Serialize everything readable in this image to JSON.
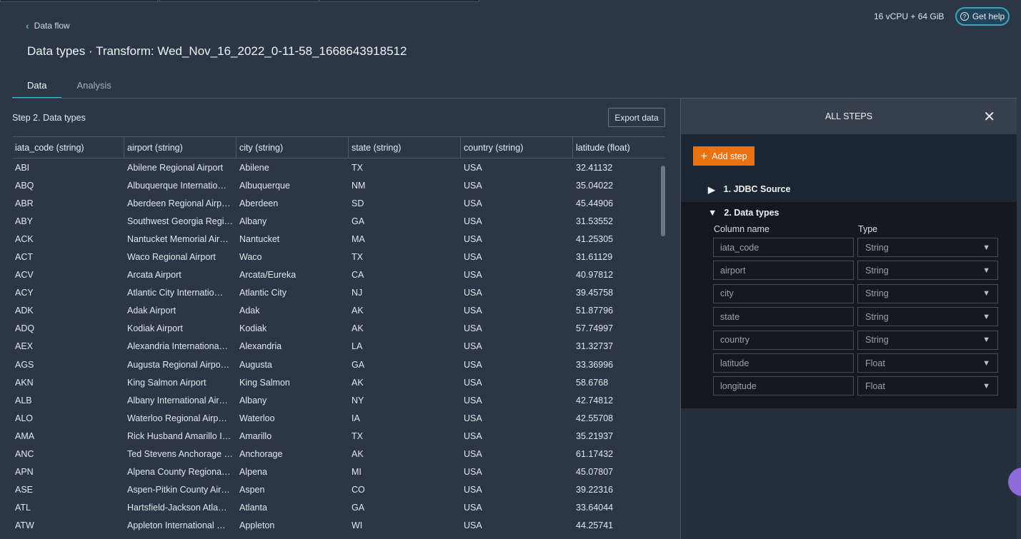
{
  "header": {
    "back_label": "Data flow",
    "title": "Data types · Transform: Wed_Nov_16_2022_0-11-58_1668643918512",
    "resources": "16 vCPU + 64 GiB",
    "help_label": "Get help"
  },
  "tabs": [
    {
      "label": "Data"
    },
    {
      "label": "Analysis"
    }
  ],
  "main": {
    "step_label": "Step 2. Data types",
    "export_label": "Export data",
    "columns": [
      "iata_code (string)",
      "airport (string)",
      "city (string)",
      "state (string)",
      "country (string)",
      "latitude (float)"
    ],
    "rows": [
      [
        "ABI",
        "Abilene Regional Airport",
        "Abilene",
        "TX",
        "USA",
        "32.41132"
      ],
      [
        "ABQ",
        "Albuquerque Internatio…",
        "Albuquerque",
        "NM",
        "USA",
        "35.04022"
      ],
      [
        "ABR",
        "Aberdeen Regional Airp…",
        "Aberdeen",
        "SD",
        "USA",
        "45.44906"
      ],
      [
        "ABY",
        "Southwest Georgia Regi…",
        "Albany",
        "GA",
        "USA",
        "31.53552"
      ],
      [
        "ACK",
        "Nantucket Memorial Air…",
        "Nantucket",
        "MA",
        "USA",
        "41.25305"
      ],
      [
        "ACT",
        "Waco Regional Airport",
        "Waco",
        "TX",
        "USA",
        "31.61129"
      ],
      [
        "ACV",
        "Arcata Airport",
        "Arcata/Eureka",
        "CA",
        "USA",
        "40.97812"
      ],
      [
        "ACY",
        "Atlantic City Internatio…",
        "Atlantic City",
        "NJ",
        "USA",
        "39.45758"
      ],
      [
        "ADK",
        "Adak Airport",
        "Adak",
        "AK",
        "USA",
        "51.87796"
      ],
      [
        "ADQ",
        "Kodiak Airport",
        "Kodiak",
        "AK",
        "USA",
        "57.74997"
      ],
      [
        "AEX",
        "Alexandria Internationa…",
        "Alexandria",
        "LA",
        "USA",
        "31.32737"
      ],
      [
        "AGS",
        "Augusta Regional Airpo…",
        "Augusta",
        "GA",
        "USA",
        "33.36996"
      ],
      [
        "AKN",
        "King Salmon Airport",
        "King Salmon",
        "AK",
        "USA",
        "58.6768"
      ],
      [
        "ALB",
        "Albany International Air…",
        "Albany",
        "NY",
        "USA",
        "42.74812"
      ],
      [
        "ALO",
        "Waterloo Regional Airp…",
        "Waterloo",
        "IA",
        "USA",
        "42.55708"
      ],
      [
        "AMA",
        "Rick Husband Amarillo I…",
        "Amarillo",
        "TX",
        "USA",
        "35.21937"
      ],
      [
        "ANC",
        "Ted Stevens Anchorage …",
        "Anchorage",
        "AK",
        "USA",
        "61.17432"
      ],
      [
        "APN",
        "Alpena County Regiona…",
        "Alpena",
        "MI",
        "USA",
        "45.07807"
      ],
      [
        "ASE",
        "Aspen-Pitkin County Air…",
        "Aspen",
        "CO",
        "USA",
        "39.22316"
      ],
      [
        "ATL",
        "Hartsfield-Jackson Atla…",
        "Atlanta",
        "GA",
        "USA",
        "33.64044"
      ],
      [
        "ATW",
        "Appleton International …",
        "Appleton",
        "WI",
        "USA",
        "44.25741"
      ]
    ]
  },
  "panel": {
    "title": "ALL STEPS",
    "add_step_label": "Add step",
    "step1_label": "1. JDBC Source",
    "step2_label": "2. Data types",
    "column_name_header": "Column name",
    "type_header": "Type",
    "fields": [
      {
        "name": "iata_code",
        "type": "String"
      },
      {
        "name": "airport",
        "type": "String"
      },
      {
        "name": "city",
        "type": "String"
      },
      {
        "name": "state",
        "type": "String"
      },
      {
        "name": "country",
        "type": "String"
      },
      {
        "name": "latitude",
        "type": "Float"
      },
      {
        "name": "longitude",
        "type": "Float"
      }
    ]
  },
  "colors": {
    "accent": "#44b9d6",
    "add_button": "#ec7211",
    "background": "#2c3646"
  }
}
